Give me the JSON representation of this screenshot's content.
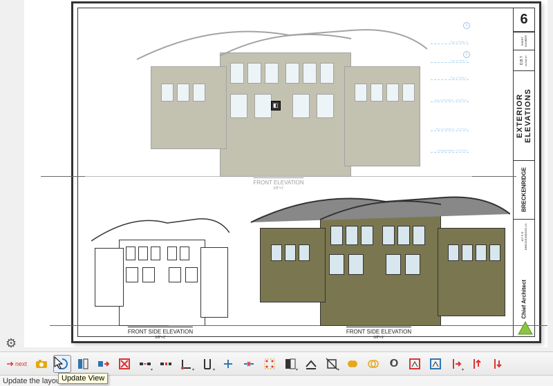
{
  "sheet": {
    "number": "6",
    "title": "EXTERIOR ELEVATIONS",
    "project": "BRECKENRIDGE",
    "address": "427 S E. BRECKENRIDGE LN.",
    "company": "Chief Architect",
    "sheet_number_label": "SHEET NUMBER",
    "drawn_by_label": "D.B.T",
    "drawn_by_sub": "DRAWN BY"
  },
  "views": {
    "front_elevation": {
      "label": "FRONT ELEVATION",
      "scale": "3/8\"=1'"
    },
    "front_side_line": {
      "label": "FRONT SIDE ELEVATION",
      "scale": "3/8\"=1'"
    },
    "front_side_color": {
      "label": "FRONT SIDE ELEVATION",
      "scale": "3/8\"=1'"
    }
  },
  "annotations": {
    "dim1": "Top of Plate 3",
    "dim2": "Top of Plate 2",
    "dim3": "Top of Plate 1",
    "dim4": "Top of Subfloor - 2nd Floor",
    "dim5": "Top of Subfloor - 1st Floor",
    "dim6": "Ceiling Height - 1st Floor"
  },
  "toolbar": {
    "next": "next",
    "camera": "camera-icon",
    "update_view": "update-view",
    "layout_box": "layout-box",
    "relink": "relink",
    "delete": "delete",
    "gap": "gap",
    "break": "break",
    "corner": "corner",
    "vertical_align": "vertical-align",
    "add": "add",
    "join": "join",
    "snap": "snap",
    "fill": "fill",
    "extrude": "extrude",
    "trim": "trim",
    "union": "union",
    "intersect": "intersect",
    "zero": "zero",
    "frame1": "frame1",
    "frame2": "frame2",
    "copy_right": "copy-right",
    "copy_up": "copy-up",
    "copy_down": "copy-down"
  },
  "status_text": "Update the layou",
  "tooltip_text": "Update View"
}
